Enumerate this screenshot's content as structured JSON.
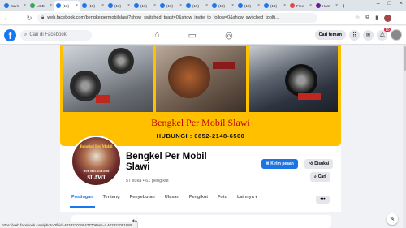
{
  "browser": {
    "tabs": [
      {
        "label": "Savin",
        "color": "#1a73e8",
        "active": false
      },
      {
        "label": "LIKE",
        "color": "#34a853",
        "active": false
      },
      {
        "label": "(10)",
        "color": "#1877f2",
        "active": true
      },
      {
        "label": "(10)",
        "color": "#1877f2",
        "active": false
      },
      {
        "label": "(10)",
        "color": "#1877f2",
        "active": false
      },
      {
        "label": "(10)",
        "color": "#1877f2",
        "active": false
      },
      {
        "label": "(10)",
        "color": "#1877f2",
        "active": false
      },
      {
        "label": "(10)",
        "color": "#1877f2",
        "active": false
      },
      {
        "label": "(10)",
        "color": "#1877f2",
        "active": false
      },
      {
        "label": "(10)",
        "color": "#1877f2",
        "active": false
      },
      {
        "label": "(10)",
        "color": "#1877f2",
        "active": false
      },
      {
        "label": "Freel",
        "color": "#e8453c",
        "active": false
      },
      {
        "label": "Has!",
        "color": "#6a1b9a",
        "active": false
      }
    ],
    "url": "web.facebook.com/bengkelpermobilslawi?show_switched_toast=0&show_invite_to_follow=0&show_switched_toolti...",
    "status_url": "https://web.facebook.com/photo/?fbid=403323078047770&set=a.403323051980..."
  },
  "facebook": {
    "logo": "f",
    "search_placeholder": "Cari di Facebook",
    "find_friends": "Cari teman",
    "notification_count": "10"
  },
  "cover": {
    "title": "Bengkel Per Mobil Slawi",
    "hotline": "HUBUNGI : 0852-2148-6500"
  },
  "avatar_text": {
    "top": "Bengkel Per Mobil",
    "middle": "HUB 0852-2148-6500",
    "bottom": "SLAWI"
  },
  "page": {
    "name": "Bengkel Per Mobil Slawi",
    "stats": "57 suka • 61 pengikut"
  },
  "actions": {
    "message": "Kirim pesan",
    "like": "Disukai",
    "search": "Cari"
  },
  "tabs": [
    "Postingan",
    "Tentang",
    "Penyebutan",
    "Ulasan",
    "Pengikut",
    "Foto",
    "Lainnya ▾"
  ],
  "more": "•••",
  "lower_text": "da",
  "colors": {
    "fb_blue": "#1877f2",
    "cover_yellow": "#ffc000",
    "cover_red": "#c00000"
  }
}
